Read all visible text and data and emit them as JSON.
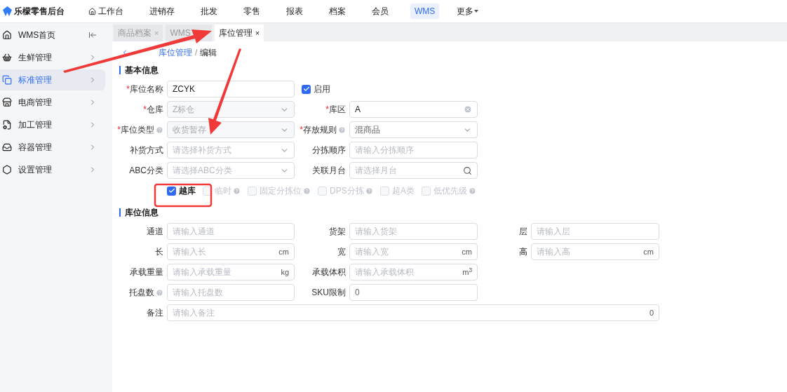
{
  "nav": {
    "brand": "乐檬零售后台",
    "items": [
      {
        "label": "工作台",
        "selected": false,
        "home": true
      },
      {
        "label": "进销存",
        "selected": false,
        "home": false
      },
      {
        "label": "批发",
        "selected": false,
        "home": false
      },
      {
        "label": "零售",
        "selected": false,
        "home": false
      },
      {
        "label": "报表",
        "selected": false,
        "home": false
      },
      {
        "label": "档案",
        "selected": false,
        "home": false
      },
      {
        "label": "会员",
        "selected": false,
        "home": false
      },
      {
        "label": "WMS",
        "selected": true,
        "home": false
      }
    ],
    "more": "更多"
  },
  "sidebar": {
    "items": [
      {
        "label": "WMS首页",
        "selected": false,
        "kind": "collapse"
      },
      {
        "label": "生鲜管理",
        "selected": false,
        "kind": "expand"
      },
      {
        "label": "标准管理",
        "selected": true,
        "kind": "expand"
      },
      {
        "label": "电商管理",
        "selected": false,
        "kind": "expand"
      },
      {
        "label": "加工管理",
        "selected": false,
        "kind": "expand"
      },
      {
        "label": "容器管理",
        "selected": false,
        "kind": "expand"
      },
      {
        "label": "设置管理",
        "selected": false,
        "kind": "expand"
      }
    ]
  },
  "tabs": [
    {
      "label": "商品档案",
      "selected": false,
      "close": "×"
    },
    {
      "label": "WMS",
      "selected": false
    },
    {
      "label": "库位管理",
      "selected": true,
      "close": "×"
    }
  ],
  "breadcrumb": {
    "items": [
      "库位管理",
      "编辑"
    ],
    "separator": "/"
  },
  "basic": {
    "title": "基本信息",
    "fields": [
      {
        "kind": "input",
        "label": "库位名称",
        "required": "*",
        "value": "ZCYK"
      },
      {
        "kind": "checkbox",
        "label": "启用",
        "checked": true
      },
      {
        "kind": "select",
        "label": "仓库",
        "required": "*",
        "value": "Z标仓",
        "disabled": true
      },
      {
        "kind": "clear",
        "label": "库区",
        "required": "*",
        "value": "A"
      },
      {
        "kind": "select",
        "label": "库位类型",
        "required": "*",
        "help": true,
        "value": "收货暂存",
        "disabled": true
      },
      {
        "kind": "select",
        "label": "存放规则",
        "required": "*",
        "help": true,
        "value": "混商品",
        "disabled": false
      },
      {
        "kind": "select",
        "label": "补货方式",
        "placeholder": "请选择补货方式"
      },
      {
        "kind": "input",
        "label": "分拣顺序",
        "placeholder": "请输入分拣顺序"
      },
      {
        "kind": "select",
        "label": "ABC分类",
        "placeholder": "请选择ABC分类"
      },
      {
        "kind": "search",
        "label": "关联月台",
        "placeholder": "请选择月台"
      }
    ],
    "options": [
      {
        "label": "越库",
        "checked": true,
        "disabled": false,
        "help": false
      },
      {
        "label": "临时",
        "checked": false,
        "disabled": true,
        "help": true
      },
      {
        "label": "固定分拣位",
        "checked": false,
        "disabled": true,
        "help": true
      },
      {
        "label": "DPS分拣",
        "checked": false,
        "disabled": true,
        "help": true
      },
      {
        "label": "超A类",
        "checked": false,
        "disabled": true,
        "help": false
      },
      {
        "label": "低优先级",
        "checked": false,
        "disabled": true,
        "help": true
      }
    ]
  },
  "location": {
    "title": "库位信息",
    "rows": [
      [
        {
          "label": "通道",
          "placeholder": "请输入通道"
        },
        {
          "label": "货架",
          "placeholder": "请输入货架"
        },
        {
          "label": "层",
          "placeholder": "请输入层"
        }
      ],
      [
        {
          "label": "长",
          "placeholder": "请输入长",
          "suffix": "cm"
        },
        {
          "label": "宽",
          "placeholder": "请输入宽",
          "suffix": "cm"
        },
        {
          "label": "高",
          "placeholder": "请输入高",
          "suffix": "cm"
        }
      ],
      [
        {
          "label": "承载重量",
          "placeholder": "请输入承载重量",
          "suffix": "kg"
        },
        {
          "label": "承载体积",
          "placeholder": "请输入承载体积",
          "suffix": "m$^{3}$"
        }
      ],
      [
        {
          "label": "托盘数",
          "help": true,
          "placeholder": "请输入托盘数"
        },
        {
          "label": "SKU限制",
          "value": "0"
        }
      ],
      [
        {
          "label": "备注",
          "placeholder": "请输入备注",
          "suffix": "0"
        }
      ]
    ]
  }
}
